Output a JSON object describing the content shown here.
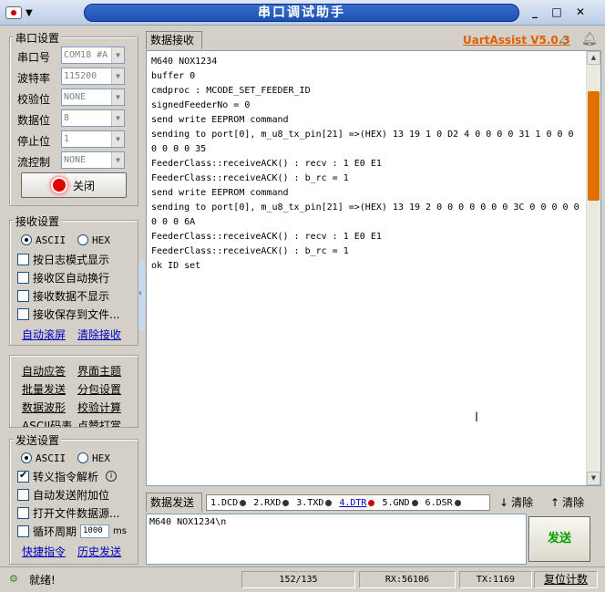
{
  "titlebar": {
    "title": "串口调试助手",
    "min": "_",
    "max": "□",
    "close": "✕"
  },
  "serial": {
    "group_title": "串口设置",
    "port_label": "串口号",
    "port_value": "COM18 #A",
    "baud_label": "波特率",
    "baud_value": "115200",
    "parity_label": "校验位",
    "parity_value": "NONE",
    "data_label": "数据位",
    "data_value": "8",
    "stop_label": "停止位",
    "stop_value": "1",
    "flow_label": "流控制",
    "flow_value": "NONE",
    "close_label": "关闭",
    "indicator_color": "#e00000"
  },
  "recv_settings": {
    "group_title": "接收设置",
    "ascii": "ASCII",
    "hex": "HEX",
    "opts": [
      "按日志模式显示",
      "接收区自动换行",
      "接收数据不显示",
      "接收保存到文件..."
    ],
    "auto_scroll": "自动滚屏",
    "clear_recv": "清除接收"
  },
  "tools": {
    "items": [
      "自动应答",
      "界面主题",
      "批量发送",
      "分包设置",
      "数据波形",
      "校验计算",
      "ASCII码表",
      "点赞打赏"
    ]
  },
  "send_settings": {
    "group_title": "发送设置",
    "ascii": "ASCII",
    "hex": "HEX",
    "escape": "转义指令解析",
    "auto_append": "自动发送附加位",
    "open_file": "打开文件数据源...",
    "cycle": "循环周期",
    "cycle_value": "1000",
    "cycle_unit": "ms",
    "shortcut": "快捷指令",
    "history": "历史发送"
  },
  "recv": {
    "tab": "数据接收",
    "brand": "UartAssist V5.0.3",
    "text": "M640 NOX1234\nbuffer 0\ncmdproc : MCODE_SET_FEEDER_ID\nsignedFeederNo = 0\nsend write EEPROM command\nsending to port[0], m_u8_tx_pin[21] =>(HEX) 13 19 1 0 D2 4 0 0 0 0 31 1 0 0 0 0 0 0 0 35\nFeederClass::receiveACK() : recv : 1 E0 E1\nFeederClass::receiveACK() : b_rc = 1\nsend write EEPROM command\nsending to port[0], m_u8_tx_pin[21] =>(HEX) 13 19 2 0 0 0 0 0 0 0 3C 0 0 0 0 0 0 0 0 6A\nFeederClass::receiveACK() : recv : 1 E0 E1\nFeederClass::receiveACK() : b_rc = 1\nok ID set"
  },
  "send": {
    "tab": "数据发送",
    "pins": [
      {
        "label": "1.DCD",
        "active": false
      },
      {
        "label": "2.RXD",
        "active": false
      },
      {
        "label": "3.TXD",
        "active": false
      },
      {
        "label": "4.DTR",
        "active": true
      },
      {
        "label": "5.GND",
        "active": false
      },
      {
        "label": "6.DSR",
        "active": false
      }
    ],
    "clear1": "清除",
    "clear2": "清除",
    "text": "M640 NOX1234\\n",
    "send_label": "发送"
  },
  "status": {
    "ready": "就绪!",
    "counter": "152/135",
    "rx": "RX:56106",
    "tx": "TX:1169",
    "reset": "复位计数"
  }
}
